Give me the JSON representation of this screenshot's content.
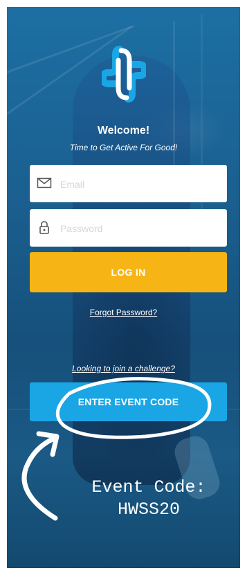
{
  "welcome": {
    "title": "Welcome!",
    "tagline": "Time to Get Active For Good!"
  },
  "login": {
    "email_placeholder": "Email",
    "password_placeholder": "Password",
    "login_label": "LOG IN",
    "forgot_label": "Forgot Password?"
  },
  "event": {
    "prompt": "Looking to join a challenge?",
    "button_label": "ENTER EVENT CODE"
  },
  "annotation": {
    "label": "Event Code:",
    "code": "HWSS20"
  },
  "icons": {
    "logo": "plus-cross-logo-icon",
    "email": "envelope-icon",
    "password": "lock-icon",
    "arrow": "curved-arrow-icon"
  },
  "colors": {
    "login_button": "#f7b515",
    "event_button": "#1aa6e4",
    "logo": "#1aa6e4"
  }
}
